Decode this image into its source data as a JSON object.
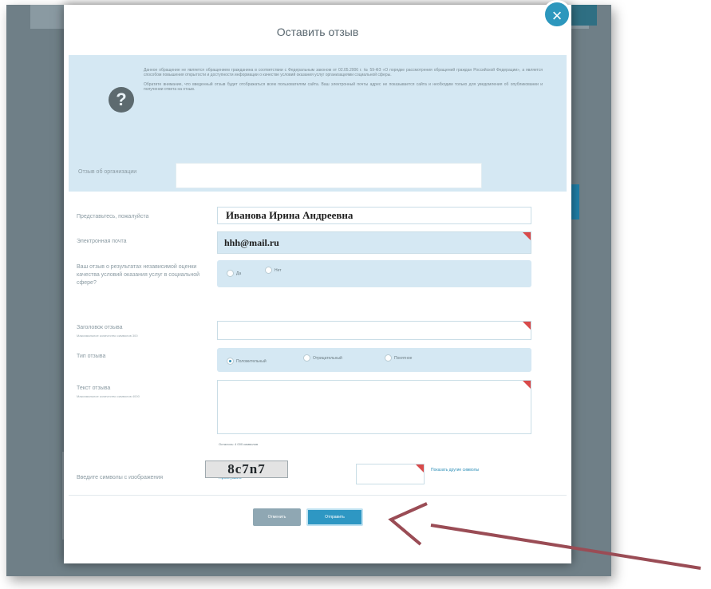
{
  "dialog": {
    "title": "Оставить отзыв",
    "close_icon": "close-icon",
    "notice_icon": "question-icon",
    "notice_paragraph_1": "Данное обращение не является обращением гражданина в соответствии с Федеральным законом от 02.05.2006 г. № 59-ФЗ «О порядке рассмотрения обращений граждан Российской Федерации», а является способом повышения открытости и доступности информации о качестве условий оказания услуг организациями социальной сферы.",
    "notice_paragraph_2": "Обратите внимание, что введенный отзыв будет отображаться всем пользователям сайта. Ваш электронный почты адрес не показывается сайта и необходим только для уведомления об опубликовании и получении ответа на отзыв."
  },
  "form": {
    "organization_label": "Отзыв об организации",
    "organization_value": "",
    "name_label": "Представьтесь, пожалуйста",
    "name_value": "Иванова Ирина Андреевна",
    "email_label": "Электронная почта",
    "email_value": "hhh@mail.ru",
    "result_label": "Ваш отзыв о результатах независимой оценки качества условий оказания услуг в социальной сфере?",
    "result_options": [
      "Да",
      "Нет"
    ],
    "title_label": "Заголовок отзыва",
    "title_hint": "Максимальное количество символов 300",
    "title_value": "",
    "type_label": "Тип отзыва",
    "type_options": [
      "Положительный",
      "Отрицательный",
      "Понятное"
    ],
    "text_label": "Текст отзыва",
    "text_hint": "Максимальное количество символов 4000",
    "text_value": "",
    "counter_text": "Осталось: 4 000 символов",
    "captcha_label": "Введите символы с изображения",
    "captcha_refresh": "Прослушать",
    "captcha_image_text": "8c7n7",
    "captcha_value": "",
    "captcha_other": "Показать другие символы"
  },
  "buttons": {
    "cancel": "Отменить",
    "send": "Отправить"
  },
  "colors": {
    "accent": "#2e97c3",
    "panel": "#d5e8f3",
    "required": "#d84a4a",
    "arrow": "#9a4c55"
  }
}
